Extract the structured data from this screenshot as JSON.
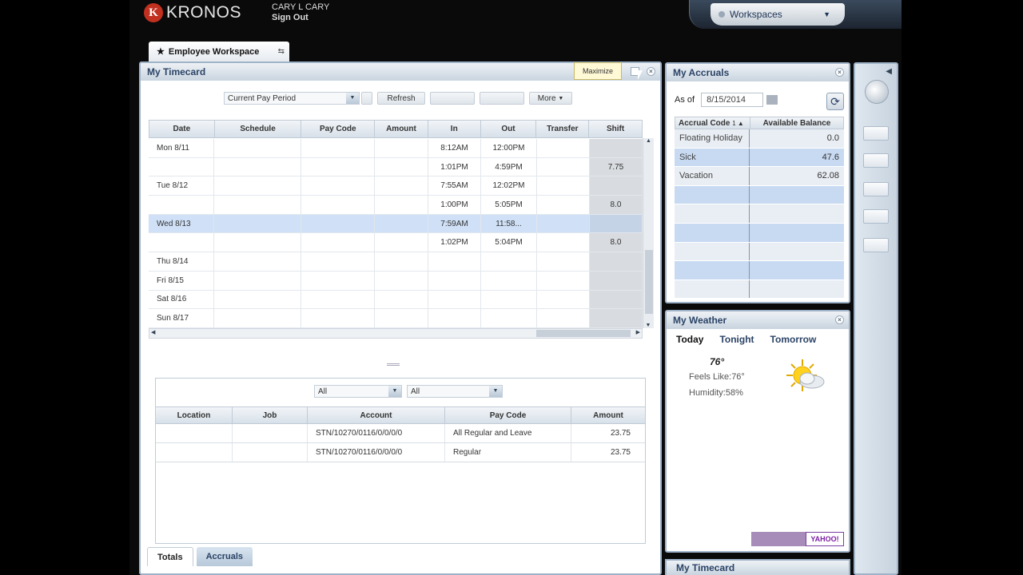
{
  "header": {
    "logo_text": "KRONOS",
    "user_name": "CARY L CARY",
    "sign_out": "Sign Out",
    "workspaces": "Workspaces",
    "workspace_tab": "Employee Workspace"
  },
  "timecard": {
    "title": "My Timecard",
    "tooltip": "Maximize",
    "period_select": "Current Pay Period",
    "refresh": "Refresh",
    "more": "More",
    "columns": [
      "Date",
      "Schedule",
      "Pay Code",
      "Amount",
      "In",
      "Out",
      "Transfer",
      "Shift"
    ],
    "rows": [
      {
        "date": "Mon 8/11",
        "in": "8:12AM",
        "out": "12:00PM",
        "shift": ""
      },
      {
        "date": "",
        "in": "1:01PM",
        "out": "4:59PM",
        "shift": "7.75"
      },
      {
        "date": "Tue 8/12",
        "in": "7:55AM",
        "out": "12:02PM",
        "shift": ""
      },
      {
        "date": "",
        "in": "1:00PM",
        "out": "5:05PM",
        "shift": "8.0"
      },
      {
        "date": "Wed 8/13",
        "in": "7:59AM",
        "out": "11:58...",
        "shift": ""
      },
      {
        "date": "",
        "in": "1:02PM",
        "out": "5:04PM",
        "shift": "8.0"
      },
      {
        "date": "Thu 8/14",
        "in": "",
        "out": "",
        "shift": ""
      },
      {
        "date": "Fri 8/15",
        "in": "",
        "out": "",
        "shift": ""
      },
      {
        "date": "Sat 8/16",
        "in": "",
        "out": "",
        "shift": ""
      },
      {
        "date": "Sun 8/17",
        "in": "",
        "out": "",
        "shift": ""
      }
    ],
    "filter1": "All",
    "filter2": "All",
    "totals_columns": [
      "Location",
      "Job",
      "Account",
      "Pay Code",
      "Amount"
    ],
    "totals_rows": [
      {
        "account": "STN/10270/0116/0/0/0/0",
        "pay_code": "All Regular and Leave",
        "amount": "23.75"
      },
      {
        "account": "STN/10270/0116/0/0/0/0",
        "pay_code": "Regular",
        "amount": "23.75"
      }
    ],
    "tab_totals": "Totals",
    "tab_accruals": "Accruals"
  },
  "accruals": {
    "title": "My Accruals",
    "as_of_label": "As of",
    "as_of_value": "8/15/2014",
    "col_code": "Accrual Code",
    "col_sort": "1 ▲",
    "col_balance": "Available Balance",
    "rows": [
      {
        "code": "Floating Holiday",
        "balance": "0.0"
      },
      {
        "code": "Sick",
        "balance": "47.6"
      },
      {
        "code": "Vacation",
        "balance": "62.08"
      },
      {
        "code": "",
        "balance": ""
      },
      {
        "code": "",
        "balance": ""
      },
      {
        "code": "",
        "balance": ""
      },
      {
        "code": "",
        "balance": ""
      },
      {
        "code": "",
        "balance": ""
      },
      {
        "code": "",
        "balance": ""
      }
    ]
  },
  "weather": {
    "title": "My Weather",
    "tabs": [
      "Today",
      "Tonight",
      "Tomorrow"
    ],
    "temp": "76°",
    "feels_like": "Feels Like:76°",
    "humidity": "Humidity:58%",
    "yahoo": "YAHOO!"
  },
  "mini_timecard": "My Timecard"
}
